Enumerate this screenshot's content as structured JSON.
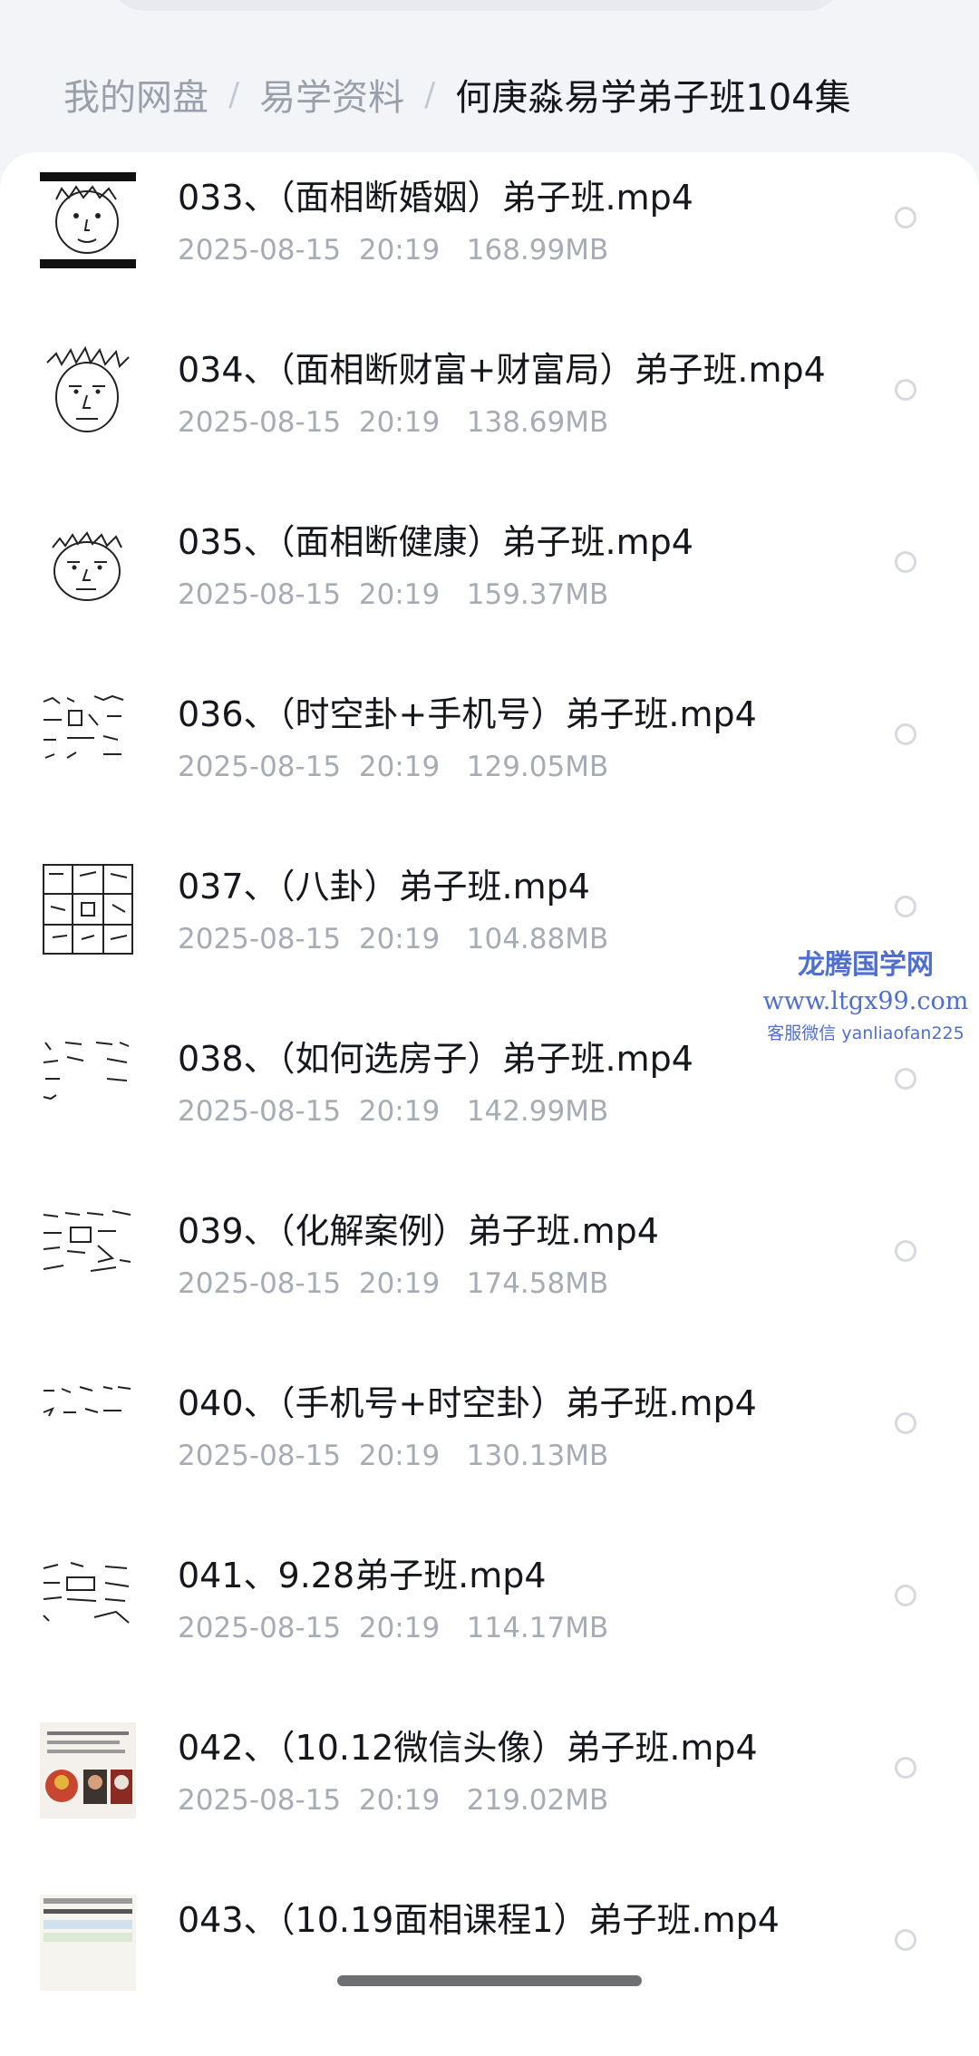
{
  "breadcrumb": {
    "root": "我的网盘",
    "folder": "易学资料",
    "current": "何庚淼易学弟子班104集",
    "separator": "/"
  },
  "files": [
    {
      "name": "033、（面相断婚姻）弟子班.mp4",
      "meta": "2025-08-15  20:19   168.99MB",
      "thumb": "face-sketch-1"
    },
    {
      "name": "034、（面相断财富+财富局）弟子班.mp4",
      "meta": "2025-08-15  20:19   138.69MB",
      "thumb": "face-sketch-2"
    },
    {
      "name": "035、（面相断健康）弟子班.mp4",
      "meta": "2025-08-15  20:19   159.37MB",
      "thumb": "face-sketch-3"
    },
    {
      "name": "036、（时空卦+手机号）弟子班.mp4",
      "meta": "2025-08-15  20:19   129.05MB",
      "thumb": "handwritten-numbers-1"
    },
    {
      "name": "037、（八卦）弟子班.mp4",
      "meta": "2025-08-15  20:19   104.88MB",
      "thumb": "bagua-grid"
    },
    {
      "name": "038、（如何选房子）弟子班.mp4",
      "meta": "2025-08-15  20:19   142.99MB",
      "thumb": "handwritten-numbers-2"
    },
    {
      "name": "039、（化解案例）弟子班.mp4",
      "meta": "2025-08-15  20:19   174.58MB",
      "thumb": "handwritten-numbers-3"
    },
    {
      "name": "040、（手机号+时空卦）弟子班.mp4",
      "meta": "2025-08-15  20:19   130.13MB",
      "thumb": "handwritten-numbers-4"
    },
    {
      "name": "041、9.28弟子班.mp4",
      "meta": "2025-08-15  20:19   114.17MB",
      "thumb": "handwritten-numbers-5"
    },
    {
      "name": "042、（10.12微信头像）弟子班.mp4",
      "meta": "2025-08-15  20:19   219.02MB",
      "thumb": "photo-collage"
    },
    {
      "name": "043、（10.19面相课程1）弟子班.mp4",
      "meta": "",
      "thumb": "document-page"
    }
  ],
  "watermark": {
    "title": "龙腾国学网",
    "url": "www.ltgx99.com",
    "contact": "客服微信 yanliaofan225",
    "color": "#4f6fd0"
  },
  "icons": {
    "select": "radio-unchecked-icon",
    "home": "home-indicator"
  }
}
